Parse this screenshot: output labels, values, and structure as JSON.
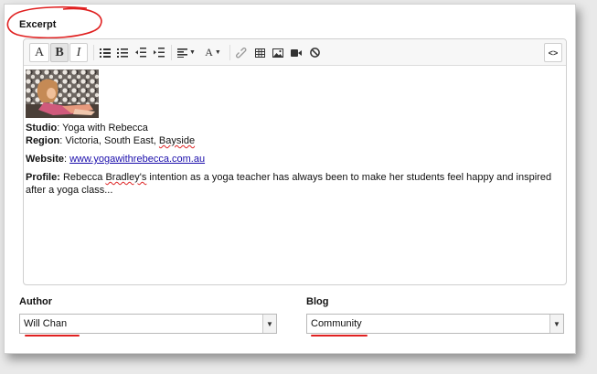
{
  "excerpt": {
    "label": "Excerpt"
  },
  "toolbar": {
    "buttons": [
      {
        "name": "font-style-button",
        "glyph": "A"
      },
      {
        "name": "bold-button",
        "glyph": "B"
      },
      {
        "name": "italic-button",
        "glyph": "I"
      },
      {
        "name": "unordered-list-button",
        "icon": "bullet-list-icon"
      },
      {
        "name": "ordered-list-button",
        "icon": "numbered-list-icon"
      },
      {
        "name": "outdent-button",
        "icon": "outdent-icon"
      },
      {
        "name": "indent-button",
        "icon": "indent-icon"
      },
      {
        "name": "align-button",
        "icon": "align-left-icon"
      },
      {
        "name": "text-color-button",
        "glyph": "A"
      },
      {
        "name": "link-button",
        "icon": "link-icon"
      },
      {
        "name": "table-button",
        "icon": "table-icon"
      },
      {
        "name": "image-button",
        "icon": "image-icon"
      },
      {
        "name": "video-button",
        "icon": "video-icon"
      },
      {
        "name": "clear-format-button",
        "icon": "block-icon"
      },
      {
        "name": "code-view-button",
        "glyph": "<>"
      }
    ],
    "bold_glyph": "B",
    "italic_glyph": "I",
    "font_glyph": "A",
    "color_glyph": "A",
    "code_glyph": "<>",
    "active_button": "bold-button"
  },
  "content": {
    "studio_label": "Studio",
    "studio_value": ": Yoga with Rebecca",
    "region_label": "Region",
    "region_value_prefix": ": Victoria, South East, ",
    "region_value_flagged": "Bayside",
    "website_label": "Website",
    "website_sep": ": ",
    "website_link": "www.yogawithrebecca.com.au",
    "profile_label": "Profile:",
    "profile_pre": "  Rebecca ",
    "profile_flagged": "Bradley's",
    "profile_post": " intention as a yoga teacher has always been to make her students feel happy and inspired after a yoga class..."
  },
  "author": {
    "label": "Author",
    "selected": "Will Chan"
  },
  "blog": {
    "label": "Blog",
    "selected": "Community"
  },
  "colors": {
    "annotation_red": "#e02020",
    "link_blue": "#1a0dab"
  }
}
